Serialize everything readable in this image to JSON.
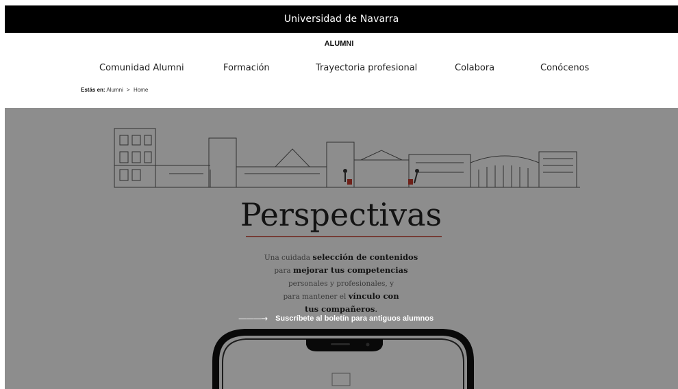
{
  "header": {
    "university": "Universidad de Navarra",
    "section": "ALUMNI"
  },
  "nav": {
    "items": [
      {
        "label": "Comunidad Alumni"
      },
      {
        "label": "Formación"
      },
      {
        "label": "Trayectoria profesional"
      },
      {
        "label": "Colabora"
      },
      {
        "label": "Conócenos"
      }
    ]
  },
  "breadcrumb": {
    "prefix": "Estás en:",
    "items": [
      "Alumni",
      "Home"
    ],
    "separator": ">"
  },
  "hero": {
    "title": "Perspectivas",
    "lines": [
      {
        "normal": "Una cuidada ",
        "bold": "selección de contenidos",
        "tail": ""
      },
      {
        "normal": "para ",
        "bold": "mejorar tus competencias",
        "tail": ""
      },
      {
        "normal": "personales y profesionales, y",
        "bold": "",
        "tail": ""
      },
      {
        "normal": "para mantener el ",
        "bold": "vínculo con",
        "tail": ""
      },
      {
        "normal": "",
        "bold": "tus compañeros",
        "tail": "."
      }
    ],
    "cta_label": "Suscríbete al boletín para antiguos alumnos",
    "accent_color": "#c0392b",
    "overlay_color": "#000000"
  }
}
